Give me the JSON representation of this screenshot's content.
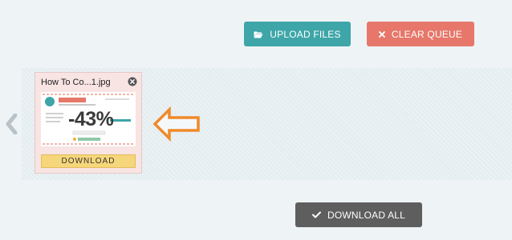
{
  "toolbar": {
    "upload_label": "UPLOAD FILES",
    "clear_label": "CLEAR QUEUE"
  },
  "file_card": {
    "title": "How To Co...1.jpg",
    "thumbnail_text": "-43%",
    "download_label": "DOWNLOAD"
  },
  "footer": {
    "download_all_label": "DOWNLOAD ALL"
  },
  "icons": {
    "upload": "folder-open-icon",
    "clear": "close-icon",
    "download_all": "checkmark-icon",
    "card_close": "close-circle-icon",
    "nav_prev": "chevron-left-icon",
    "annotation": "arrow-left-outline-icon"
  },
  "colors": {
    "upload_button": "#3ea5a8",
    "clear_button": "#e6776a",
    "download_all_button": "#5e5e5e",
    "card_background": "#f8e4e3",
    "card_download_button": "#f6d67a",
    "annotation_arrow": "#f08a2a"
  }
}
